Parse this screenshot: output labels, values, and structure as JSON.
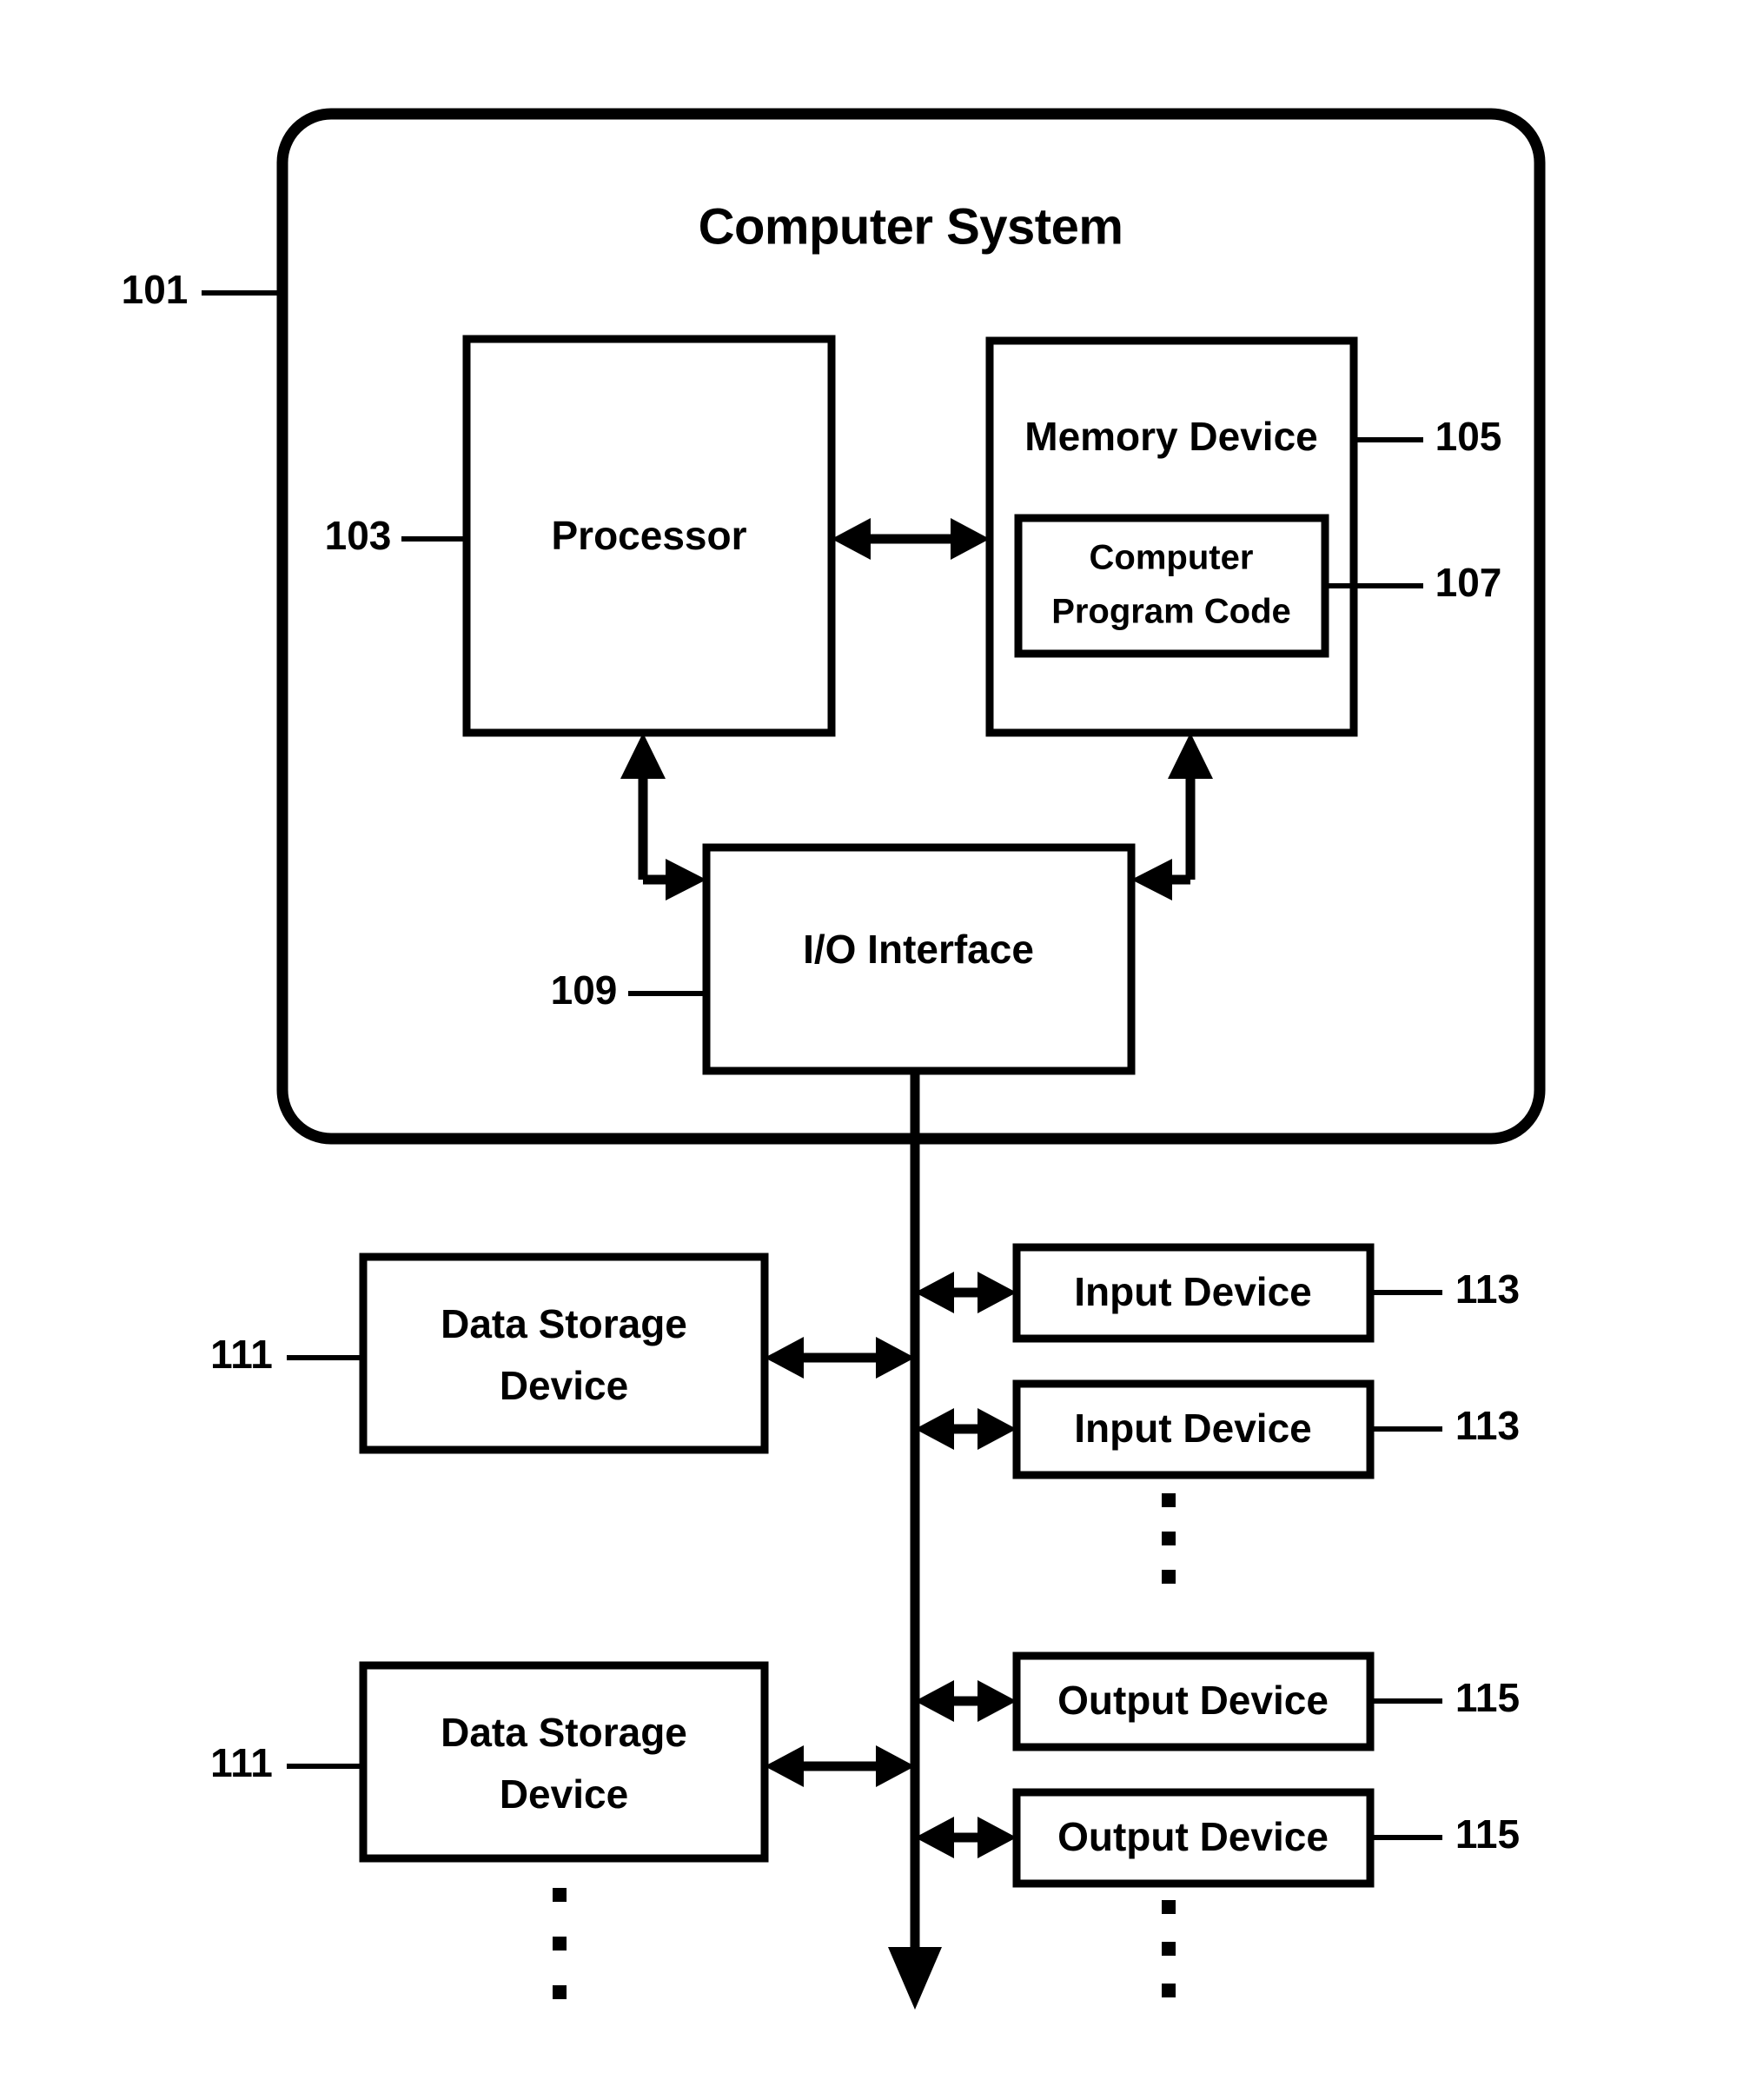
{
  "figure": {
    "title": "Computer System",
    "background_color": "#ffffff",
    "line_color": "#000000"
  },
  "system": {
    "label": "Computer System",
    "reference_number": "101"
  },
  "blocks": [
    {
      "id": "processor",
      "label": "Processor",
      "reference_number": "103",
      "reference_side": "left"
    },
    {
      "id": "memory-device",
      "label": "Memory Device",
      "reference_number": "105",
      "reference_side": "right"
    },
    {
      "id": "computer-program-code",
      "label_line1": "Computer",
      "label_line2": "Program Code",
      "reference_number": "107",
      "reference_side": "right"
    },
    {
      "id": "io-interface",
      "label": "I/O Interface",
      "reference_number": "109",
      "reference_side": "left"
    },
    {
      "id": "data-storage-device-1",
      "label_line1": "Data Storage",
      "label_line2": "Device",
      "reference_number": "111",
      "reference_side": "left"
    },
    {
      "id": "data-storage-device-2",
      "label_line1": "Data Storage",
      "label_line2": "Device",
      "reference_number": "111",
      "reference_side": "left"
    },
    {
      "id": "input-device-1",
      "label": "Input Device",
      "reference_number": "113",
      "reference_side": "right"
    },
    {
      "id": "input-device-2",
      "label": "Input Device",
      "reference_number": "113",
      "reference_side": "right"
    },
    {
      "id": "output-device-1",
      "label": "Output Device",
      "reference_number": "115",
      "reference_side": "right"
    },
    {
      "id": "output-device-2",
      "label": "Output Device",
      "reference_number": "115",
      "reference_side": "right"
    }
  ],
  "labels": {
    "title": "Computer System",
    "processor": "Processor",
    "memory_device": "Memory Device",
    "program_code_line1": "Computer",
    "program_code_line2": "Program Code",
    "io_interface": "I/O Interface",
    "data_storage_line1": "Data Storage",
    "data_storage_line2": "Device",
    "input_device": "Input Device",
    "output_device": "Output Device"
  },
  "refs": {
    "system": "101",
    "processor": "103",
    "memory_device": "105",
    "program_code": "107",
    "io_interface": "109",
    "data_storage_1": "111",
    "data_storage_2": "111",
    "input_device_1": "113",
    "input_device_2": "113",
    "output_device_1": "115",
    "output_device_2": "115"
  },
  "ellipses": {
    "input_column": "vertical-ellipsis",
    "output_column": "vertical-ellipsis",
    "data_storage_column": "vertical-ellipsis"
  }
}
